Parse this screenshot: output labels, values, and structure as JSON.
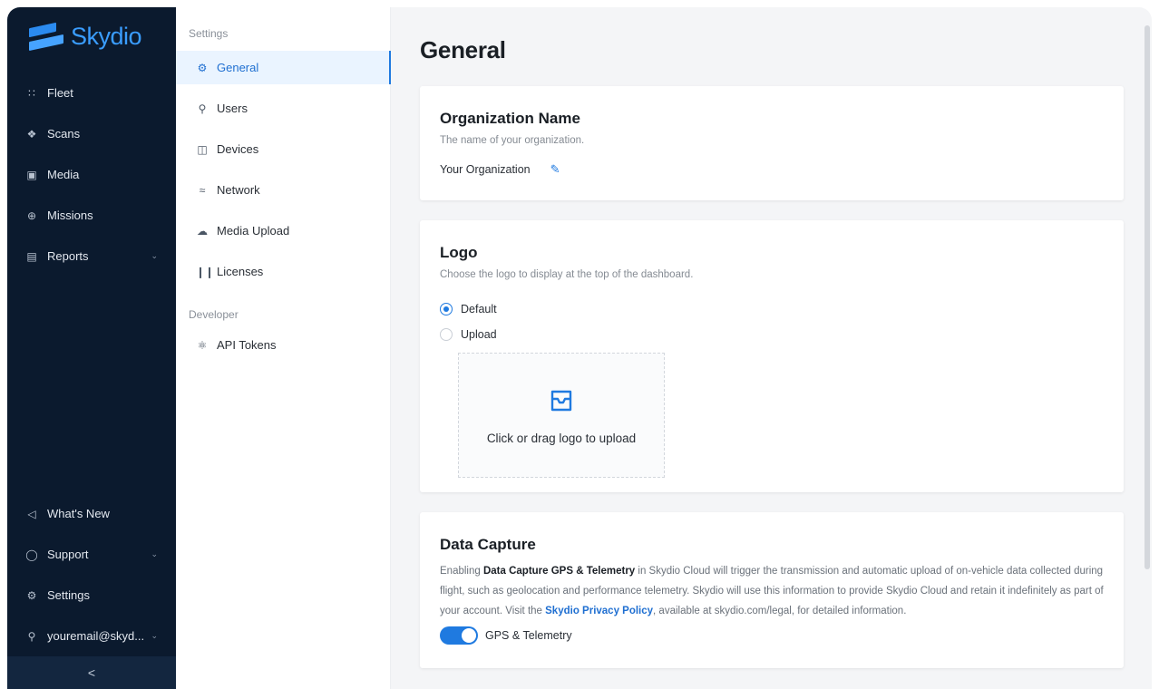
{
  "brand": {
    "name": "Skydio"
  },
  "nav": {
    "items": [
      {
        "label": "Fleet",
        "icon": "fleet-icon"
      },
      {
        "label": "Scans",
        "icon": "scans-icon"
      },
      {
        "label": "Media",
        "icon": "media-icon"
      },
      {
        "label": "Missions",
        "icon": "missions-icon"
      },
      {
        "label": "Reports",
        "icon": "reports-icon"
      }
    ],
    "bottom": [
      {
        "label": "What's New",
        "icon": "megaphone-icon"
      },
      {
        "label": "Support",
        "icon": "support-icon"
      },
      {
        "label": "Settings",
        "icon": "gear-icon"
      },
      {
        "label": "youremail@skyd...",
        "icon": "user-icon"
      }
    ],
    "collapse_glyph": "<"
  },
  "subnav": {
    "group_settings": "Settings",
    "group_developer": "Developer",
    "items": [
      {
        "label": "General"
      },
      {
        "label": "Users"
      },
      {
        "label": "Devices"
      },
      {
        "label": "Network"
      },
      {
        "label": "Media Upload"
      },
      {
        "label": "Licenses"
      }
    ],
    "dev_items": [
      {
        "label": "API Tokens"
      }
    ]
  },
  "main": {
    "title": "General",
    "org": {
      "heading": "Organization Name",
      "desc": "The name of your organization.",
      "value": "Your Organization"
    },
    "logo": {
      "heading": "Logo",
      "desc": "Choose the logo to display at the top of the dashboard.",
      "option_default": "Default",
      "option_upload": "Upload",
      "upload_text": "Click or drag logo to upload",
      "selected": "Default"
    },
    "data_capture": {
      "heading": "Data Capture",
      "text_1": "Enabling ",
      "text_bold": "Data Capture GPS & Telemetry",
      "text_2": " in Skydio Cloud will trigger the transmission and automatic upload of on-vehicle data collected during flight, such as geolocation and performance telemetry. Skydio will use this information to provide Skydio Cloud and retain it indefinitely as part of your account. Visit the ",
      "link": "Skydio Privacy Policy",
      "text_3": ", available at skydio.com/legal, for detailed information.",
      "toggle_label": "GPS & Telemetry",
      "toggle_on": true
    }
  },
  "colors": {
    "nav_bg": "#0b1a2e",
    "accent": "#1f7ae0",
    "brand": "#3a9dff"
  }
}
